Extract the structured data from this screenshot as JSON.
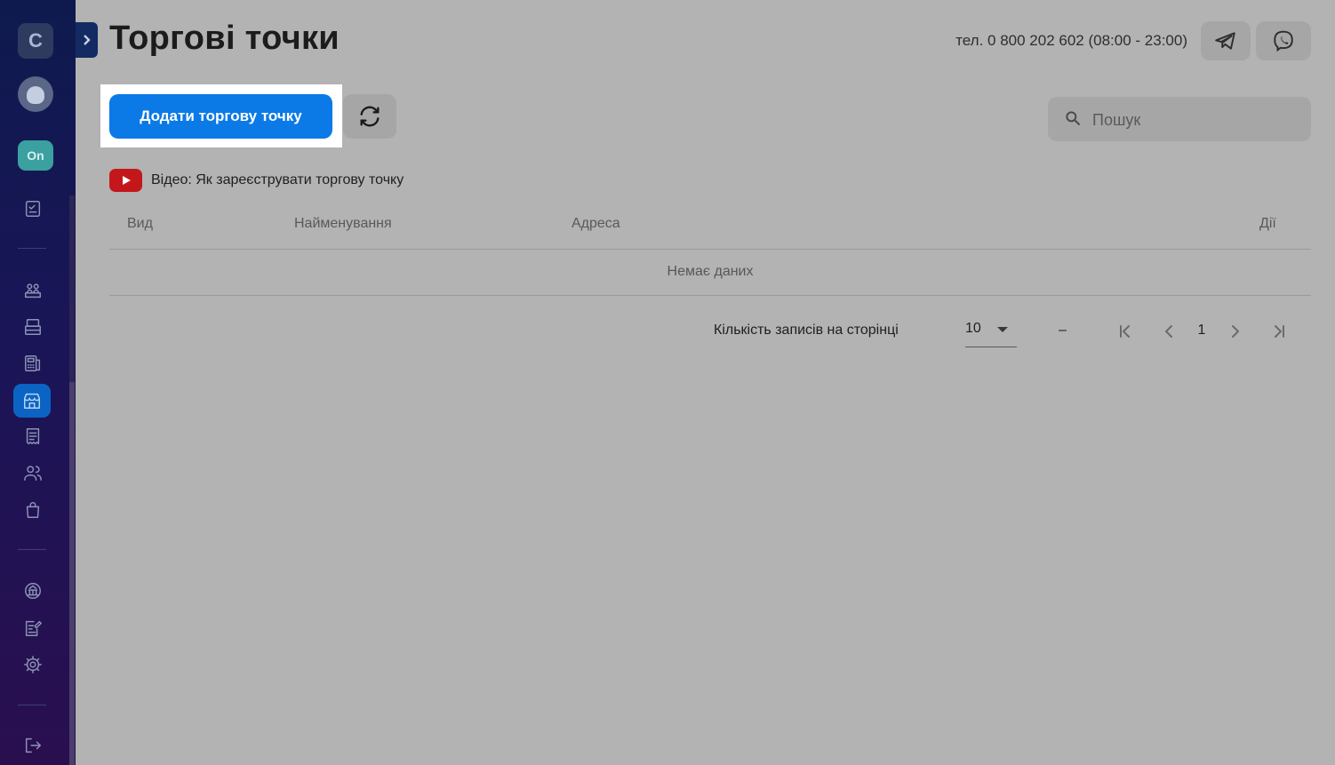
{
  "sidebar": {
    "logo_letter": "C",
    "status_badge": "On",
    "active_item": "stores",
    "colors": {
      "active": "#0b64c4",
      "badge": "#3aa0a0"
    }
  },
  "header": {
    "title": "Торгові точки",
    "phone": "тел. 0 800 202 602 (08:00 - 23:00)",
    "icons": [
      "telegram-icon",
      "viber-icon"
    ]
  },
  "toolbar": {
    "add_label": "Додати торгову точку",
    "search_placeholder": "Пошук",
    "accent": "#0b7ae6"
  },
  "video": {
    "label": "Відео: Як зареєструвати торгову точку"
  },
  "table": {
    "columns": [
      "Вид",
      "Найменування",
      "Адреса",
      "Дії"
    ],
    "empty_text": "Немає даних"
  },
  "pagination": {
    "rows_label": "Кількість записів на сторінці",
    "rows_value": "10",
    "range": "–",
    "page": "1"
  }
}
